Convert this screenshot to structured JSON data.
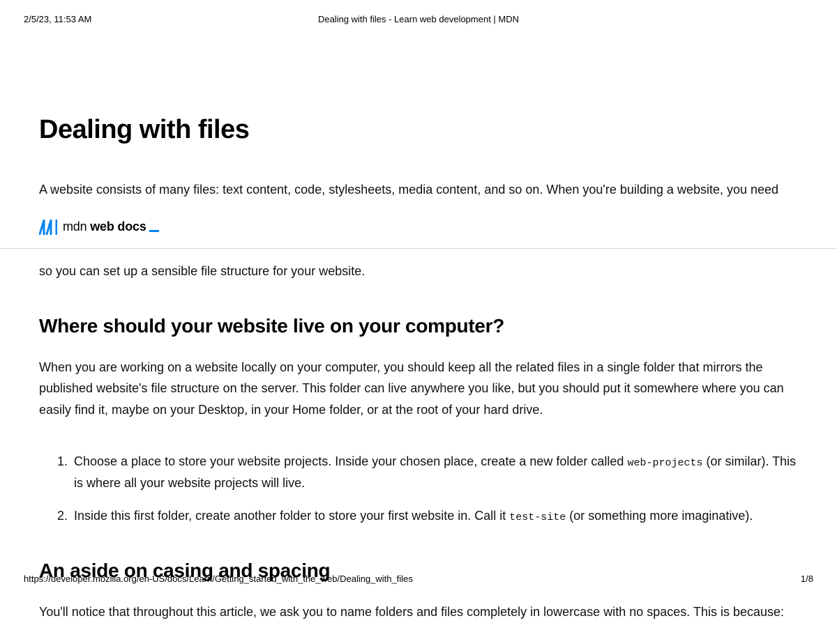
{
  "print": {
    "timestamp": "2/5/23, 11:53 AM",
    "doc_title": "Dealing with files - Learn web development | MDN",
    "footer_url": "https://developer.mozilla.org/en-US/docs/Learn/Getting_started_with_the_web/Dealing_with_files",
    "page_indicator": "1/8"
  },
  "logo": {
    "text_plain": "mdn ",
    "text_bold": "web docs"
  },
  "article": {
    "h1": "Dealing with files",
    "intro_visible_line": "A website consists of many files: text content, code, stylesheets, media content, and so on. When you're building a website, you need",
    "intro_after_logo": "so you can set up a sensible file structure for your website.",
    "h2_where": "Where should your website live on your computer?",
    "where_para": "When you are working on a website locally on your computer, you should keep all the related files in a single folder that mirrors the published website's file structure on the server. This folder can live anywhere you like, but you should put it somewhere where you can easily find it, maybe on your Desktop, in your Home folder, or at the root of your hard drive.",
    "steps": {
      "s1_a": "Choose a place to store your website projects. Inside your chosen place, create a new folder called ",
      "s1_code": "web-projects",
      "s1_b": " (or similar). This is where all your website projects will live.",
      "s2_a": "Inside this first folder, create another folder to store your first website in. Call it ",
      "s2_code": "test-site",
      "s2_b": " (or something more imaginative)."
    },
    "h2_casing": "An aside on casing and spacing",
    "casing_para": "You'll notice that throughout this article, we ask you to name folders and files completely in lowercase with no spaces. This is because:"
  }
}
